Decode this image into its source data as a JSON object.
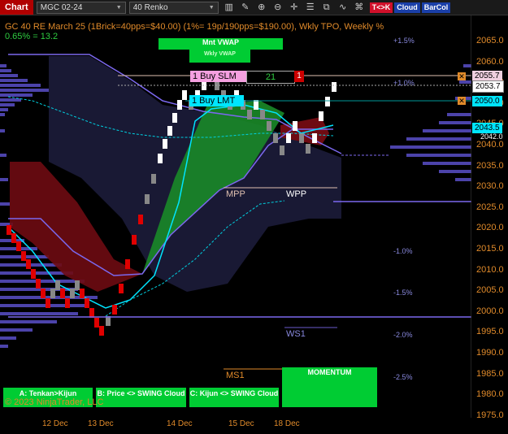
{
  "toolbar": {
    "chart_label": "Chart",
    "instrument": "MGC 02-24",
    "bar_type": "40 Renko",
    "tk_label": "T<>K",
    "cloud_label": "Cloud",
    "barcol_label": "BarCol"
  },
  "header": {
    "title": "GC 40 RE March 25 (1Brick=40pps=$40.00)  (1%= 19p/190pps=$190.00), Wkly TPO, Weekly %",
    "percent": "0.65% = 13.2"
  },
  "price_axis": [
    "2065.0",
    "2060.0",
    "2055.0",
    "2050.0",
    "2045.0",
    "2040.0",
    "2035.0",
    "2030.0",
    "2025.0",
    "2020.0",
    "2015.0",
    "2010.0",
    "2005.0",
    "2000.0",
    "1995.0",
    "1990.0",
    "1985.0",
    "1980.0",
    "1975.0"
  ],
  "percent_labels": [
    "+1.5%",
    "+1.0%",
    "-1.0%",
    "-1.5%",
    "-2.0%",
    "-2.5%"
  ],
  "price_tags": {
    "last": "2053.7",
    "top": "2055.7",
    "mid": "2050.0",
    "cyan": "2043.5",
    "small": "2042.0"
  },
  "dates": [
    "12 Dec",
    "13 Dec",
    "14 Dec",
    "15 Dec",
    "18 Dec"
  ],
  "orders": {
    "buy_slm": "1 Buy SLM",
    "qty": "21",
    "count": "1",
    "buy_lmt": "1 Buy LMT"
  },
  "levels": {
    "mnt_vwap": "Mnt VWAP",
    "wkly_vwap": "Wkly VWAP",
    "mpp": "MPP",
    "wpp": "WPP",
    "ws1": "WS1",
    "ms1": "MS1",
    "momentum": "MOMENTUM"
  },
  "buttons": {
    "a": "A: Tenkan>Kijun",
    "b": "B: Price <> SWING Cloud",
    "c": "C: Kijun <> SWING Cloud"
  },
  "copyright": "© 2023 NinjaTrader, LLC",
  "colors": {
    "accent_orange": "#e08a2a",
    "cloud_green": "#1f9e2a",
    "cloud_red": "#7a0c12",
    "tpo_purple": "#6a5acd",
    "cyan": "#00e5ff"
  }
}
